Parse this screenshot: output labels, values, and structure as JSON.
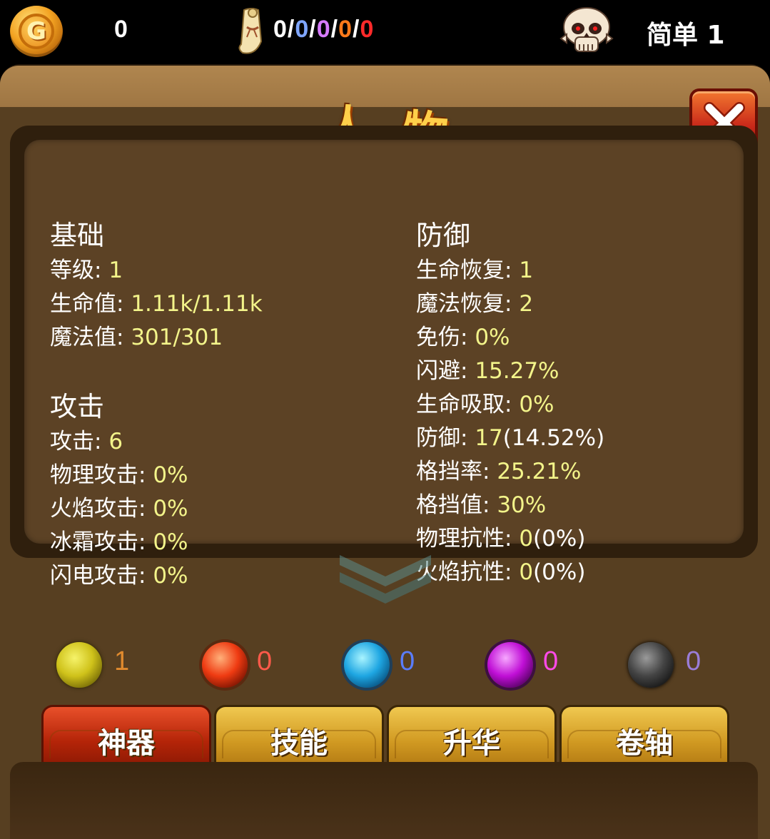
{
  "topbar": {
    "gold_icon_letter": "G",
    "gold_value": "0",
    "keys": {
      "white": "0",
      "blue": "0",
      "purple": "0",
      "orange": "0",
      "red": "0",
      "separator": "/",
      "colors": {
        "white": "#ffffff",
        "blue": "#7fa6ff",
        "purple": "#d77bff",
        "orange": "#ff7a1a",
        "red": "#ff2a2a"
      }
    },
    "difficulty": "简单 1"
  },
  "panel": {
    "title": "人 物"
  },
  "stats": {
    "basic": {
      "heading": "基础",
      "rows": [
        {
          "label": "等级: ",
          "value": "1"
        },
        {
          "label": "生命值: ",
          "value": "1.11k/1.11k"
        },
        {
          "label": "魔法值: ",
          "value": "301/301"
        }
      ]
    },
    "attack": {
      "heading": "攻击",
      "rows": [
        {
          "label": "攻击: ",
          "value": "6"
        },
        {
          "label": "物理攻击: ",
          "value": "0%"
        },
        {
          "label": "火焰攻击: ",
          "value": "0%"
        },
        {
          "label": "冰霜攻击: ",
          "value": "0%"
        },
        {
          "label": "闪电攻击: ",
          "value": "0%"
        }
      ]
    },
    "defense": {
      "heading": "防御",
      "rows": [
        {
          "label": "生命恢复: ",
          "value": "1",
          "suffix": ""
        },
        {
          "label": "魔法恢复: ",
          "value": "2",
          "suffix": ""
        },
        {
          "label": "免伤: ",
          "value": "0%",
          "suffix": ""
        },
        {
          "label": "闪避: ",
          "value": "15.27%",
          "suffix": ""
        },
        {
          "label": "生命吸取: ",
          "value": "0%",
          "suffix": ""
        },
        {
          "label": "防御: ",
          "value": "17",
          "suffix": "(14.52%)"
        },
        {
          "label": "格挡率: ",
          "value": "25.21%",
          "suffix": ""
        },
        {
          "label": "格挡值: ",
          "value": "30%",
          "suffix": ""
        },
        {
          "label": "物理抗性: ",
          "value": "0",
          "suffix": "(0%)"
        },
        {
          "label": "火焰抗性: ",
          "value": "0",
          "suffix": "(0%)"
        }
      ]
    }
  },
  "orbs": [
    {
      "name": "yellow",
      "count": "1",
      "count_color": "#e08a2e"
    },
    {
      "name": "red",
      "count": "0",
      "count_color": "#ff5a4a"
    },
    {
      "name": "blue",
      "count": "0",
      "count_color": "#5a7dff"
    },
    {
      "name": "purple",
      "count": "0",
      "count_color": "#ff4ae8"
    },
    {
      "name": "black",
      "count": "0",
      "count_color": "#9a7dd8"
    }
  ],
  "tabs": [
    {
      "label": "神器",
      "active": true
    },
    {
      "label": "技能",
      "active": false
    },
    {
      "label": "升华",
      "active": false
    },
    {
      "label": "卷轴",
      "active": false
    }
  ]
}
